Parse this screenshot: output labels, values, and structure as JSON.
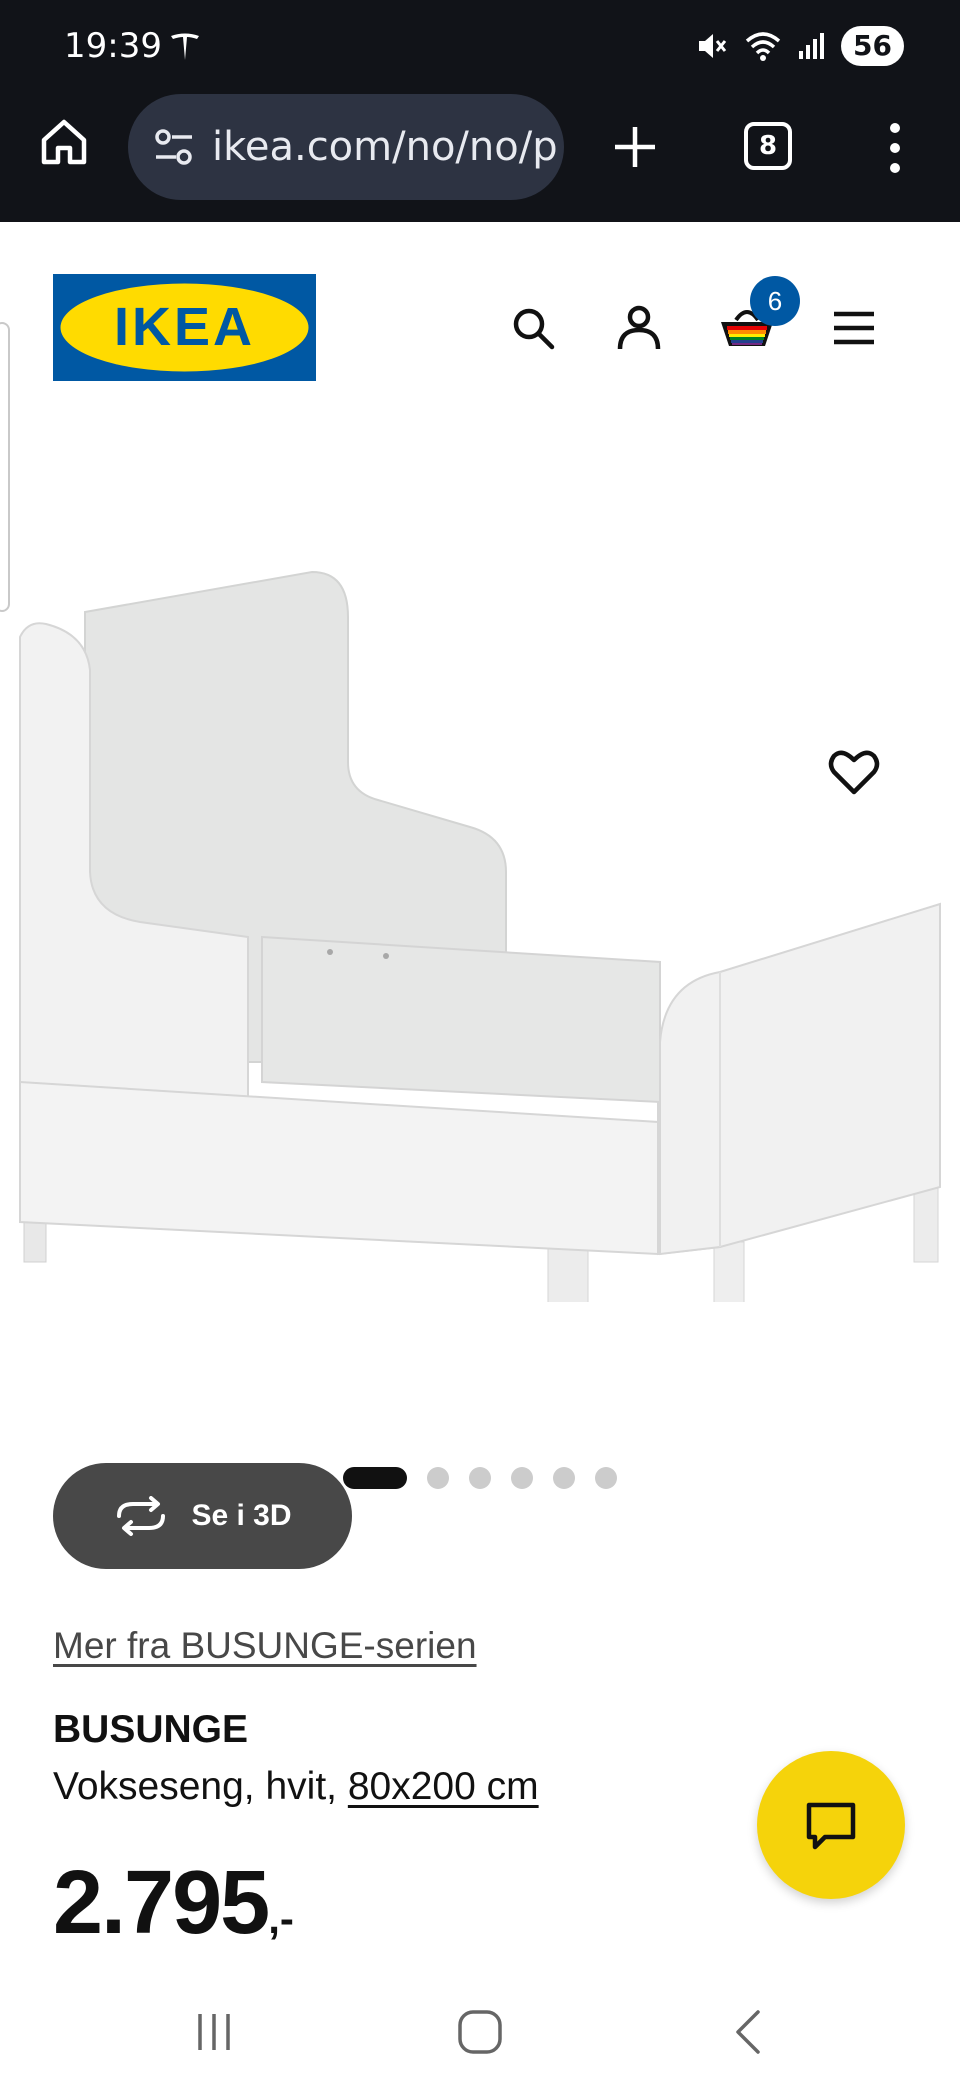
{
  "status_bar": {
    "time": "19:39",
    "battery": "56",
    "icons": [
      "tesla-icon",
      "mute-icon",
      "wifi-icon",
      "signal-icon"
    ]
  },
  "browser": {
    "url": "ikea.com/no/no/p",
    "tab_count": "8",
    "icons": [
      "home-icon",
      "site-settings-icon",
      "plus-icon",
      "more-vertical-icon"
    ]
  },
  "header": {
    "logo_text": "IKEA",
    "cart_count": "6",
    "icons": [
      "search-icon",
      "account-icon",
      "shopping-bag-icon",
      "hamburger-menu-icon"
    ],
    "colors": {
      "logo_blue": "#0058a3",
      "logo_yellow": "#ffdb00",
      "badge": "#0058a3"
    }
  },
  "media": {
    "view3d_label": "Se i 3D",
    "slides_total": 6,
    "active_slide": 1
  },
  "product": {
    "series_link": "Mer fra BUSUNGE-serien",
    "name": "BUSUNGE",
    "description": "Vokseseng, hvit, ",
    "size_link": "80x200 cm",
    "price": "2.795",
    "price_suffix": ",-"
  },
  "chat": {
    "color": "#f5d30b",
    "icon": "chat-icon"
  },
  "nav_bar": {
    "icons": [
      "recents-icon",
      "home-circle-icon",
      "back-icon"
    ]
  }
}
